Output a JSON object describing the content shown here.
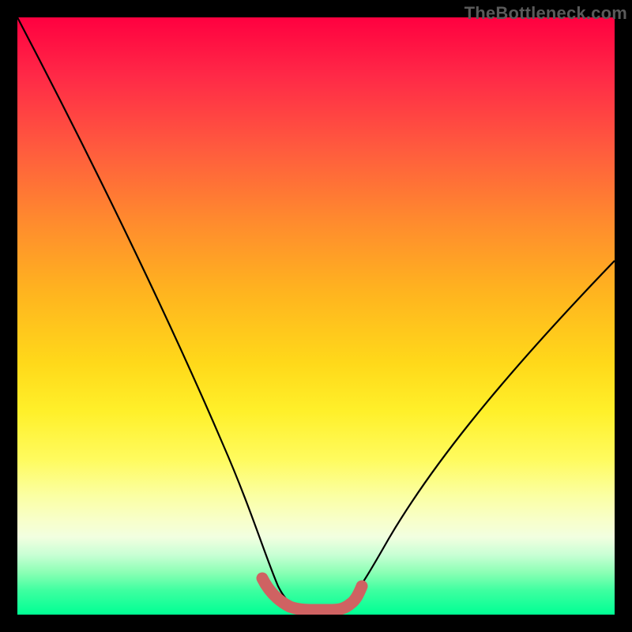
{
  "watermark": "TheBottleneck.com",
  "chart_data": {
    "type": "line",
    "title": "",
    "xlabel": "",
    "ylabel": "",
    "xlim": [
      0,
      100
    ],
    "ylim": [
      0,
      100
    ],
    "series": [
      {
        "name": "curve",
        "x": [
          0,
          5,
          10,
          15,
          20,
          25,
          30,
          35,
          38,
          40,
          42,
          45,
          48,
          50,
          55,
          60,
          65,
          70,
          75,
          80,
          85,
          90,
          95,
          100
        ],
        "values": [
          100,
          90,
          80,
          71,
          62,
          52,
          42,
          30,
          20,
          12,
          6,
          2,
          0,
          0,
          3,
          8,
          14,
          20,
          26,
          32,
          38,
          43,
          48,
          53
        ]
      },
      {
        "name": "highlight",
        "x": [
          40,
          42,
          44,
          46,
          48,
          50,
          52,
          54
        ],
        "values": [
          6,
          3.5,
          2.3,
          2.5,
          2.5,
          2.5,
          3.3,
          5.8
        ]
      }
    ],
    "background_gradient": {
      "top": "#ff0040",
      "mid": "#ffe030",
      "bottom": "#00ff94"
    },
    "highlight_color": "#cf6060"
  }
}
